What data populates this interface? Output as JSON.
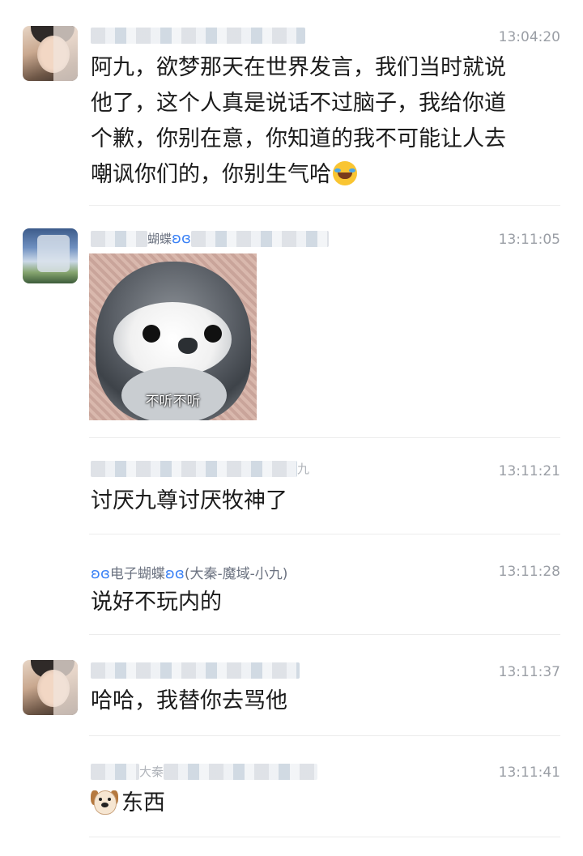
{
  "messages": [
    {
      "time": "13:04:20",
      "text_lines": [
        "阿九，欲梦那天在世界发言，我们当时就说",
        "他了，这个人真是说话不过脑子，我给你道",
        "个歉，你别在意，你知道的我不可能让人去",
        "嘲讽你们的，你别生气哈"
      ],
      "emoji": "face-with-tears-of-joy-emoji"
    },
    {
      "time": "13:11:05",
      "name_fragment": "蝴蝶",
      "sticker_caption": "不听不听"
    },
    {
      "time": "13:11:21",
      "name_fragment": "九",
      "text": "讨厌九尊讨厌牧神了"
    },
    {
      "time": "13:11:28",
      "name": "电子蝴蝶",
      "name_suffix": "(大秦-魔域-小九)",
      "text": "说好不玩内的"
    },
    {
      "time": "13:11:37",
      "text": "哈哈，我替你去骂他"
    },
    {
      "time": "13:11:41",
      "name_fragment": "大秦",
      "text": "东西",
      "emoji": "dog-face-emoji"
    }
  ],
  "colors": {
    "timestamp": "#9a9ea5",
    "name": "#6b7280",
    "text": "#1b1b1b",
    "divider": "#ececec"
  }
}
